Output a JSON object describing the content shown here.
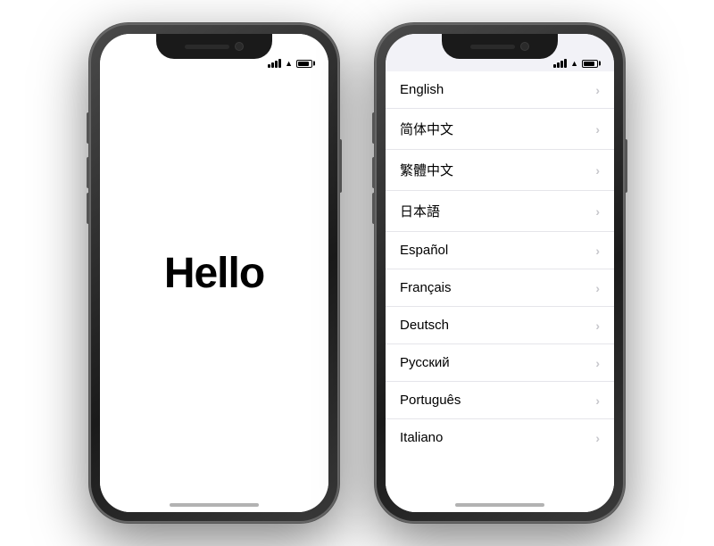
{
  "phones": [
    {
      "id": "hello-phone",
      "screen": "hello",
      "hello": {
        "text": "Hello"
      },
      "statusBar": {
        "signal": "●●●●",
        "wifi": "WiFi",
        "battery": "100"
      }
    },
    {
      "id": "language-phone",
      "screen": "language",
      "statusBar": {
        "signal": "●●●●",
        "wifi": "WiFi",
        "battery": "100"
      },
      "languages": [
        {
          "id": "english",
          "name": "English"
        },
        {
          "id": "simplified-chinese",
          "name": "简体中文"
        },
        {
          "id": "traditional-chinese",
          "name": "繁體中文"
        },
        {
          "id": "japanese",
          "name": "日本語"
        },
        {
          "id": "spanish",
          "name": "Español"
        },
        {
          "id": "french",
          "name": "Français"
        },
        {
          "id": "german",
          "name": "Deutsch"
        },
        {
          "id": "russian",
          "name": "Русский"
        },
        {
          "id": "portuguese",
          "name": "Português"
        },
        {
          "id": "italian",
          "name": "Italiano"
        }
      ]
    }
  ]
}
